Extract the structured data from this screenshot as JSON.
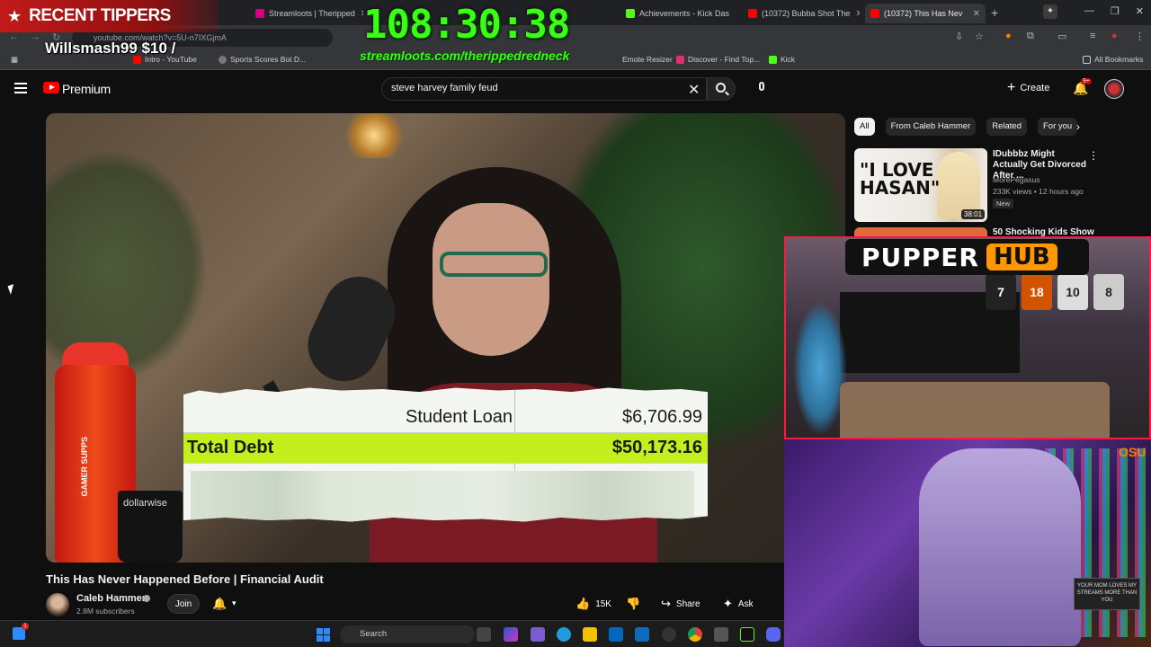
{
  "browser": {
    "tabs": [
      {
        "label": "Streamloots | Theripped",
        "active": false
      },
      {
        "label": "Achievements - Kick Das",
        "active": false
      },
      {
        "label": "(10372) Bubba Shot The",
        "active": false
      },
      {
        "label": "(10372) This Has Nev",
        "active": true
      }
    ],
    "address": "youtube.com/watch?v=5U-n7IXGjmA",
    "bookmarks": [
      "Intro - YouTube",
      "Sports Scores Bot D...",
      "Emote Resizer",
      "Discover - Find Top...",
      "Kick",
      "All Bookmarks"
    ]
  },
  "overlay": {
    "tippers_label": "RECENT TIPPERS",
    "tipper_entry": "Willsmash99 $10 /",
    "timer": "108:30:38",
    "stream_url": "streamloots.com/therippedredneck",
    "hub_word1": "PUPPER",
    "hub_word2": "HUB"
  },
  "header": {
    "brand": "Premium",
    "search_value": "steve harvey family feud",
    "create_label": "Create",
    "notification_count": "9+"
  },
  "video": {
    "debt_rows": [
      {
        "label": "Student Loan",
        "value": "$6,706.99"
      },
      {
        "label": "Total Debt",
        "value": "$50,173.16"
      }
    ],
    "bottle_brand": "GAMER SUPPS",
    "mug_brand": "dollarwise"
  },
  "meta": {
    "title": "This Has Never Happened Before | Financial Audit",
    "channel": "Caleb Hammer",
    "subscribers": "2.8M subscribers",
    "join_label": "Join",
    "likes": "15K",
    "share_label": "Share",
    "ask_label": "Ask"
  },
  "sidebar": {
    "chips": [
      "All",
      "From Caleb Hammer",
      "Related",
      "For you"
    ],
    "rec1": {
      "thumb_text": "\"I LOVE HASAN\"",
      "duration": "38:01",
      "title": "IDubbbz Might Actually Get Divorced After ...",
      "channel": "MorePegasus",
      "meta": "233K views • 12 hours ago",
      "badge": "New"
    },
    "rec2": {
      "title": "50 Shocking Kids Show"
    }
  },
  "cam1": {
    "jerseys": [
      "7",
      "18",
      "10",
      "8"
    ]
  },
  "cam2": {
    "logo": "OSU",
    "sign": "YOUR MOM LOVES MY STREAMS MORE THAN YOU"
  },
  "taskbar": {
    "search_label": "Search",
    "widget_badge": "1"
  }
}
